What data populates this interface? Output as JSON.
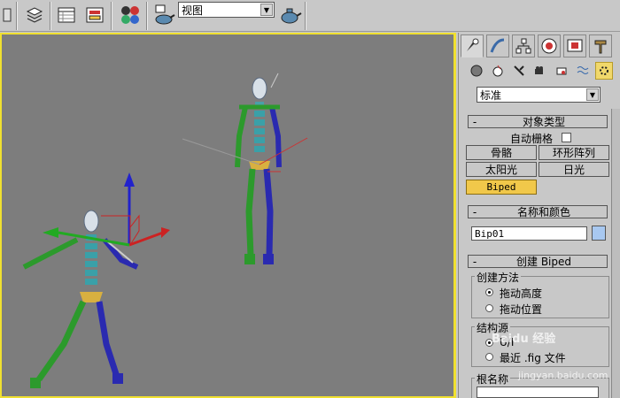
{
  "toolbar": {
    "view_dropdown": "视图",
    "icons": [
      "layers-icon",
      "track-view-icon",
      "schematic-icon",
      "material-editor-icon",
      "render-setup-icon",
      "quick-render-icon"
    ]
  },
  "panel": {
    "tabs": [
      "create-tab",
      "modify-tab",
      "hierarchy-tab",
      "motion-tab",
      "display-tab",
      "utilities-tab"
    ],
    "sub_icons": [
      "geometry-icon",
      "shapes-icon",
      "lights-icon",
      "cameras-icon",
      "helpers-icon",
      "space-warps-icon",
      "systems-icon"
    ],
    "category": "标准",
    "object_type": {
      "title": "对象类型",
      "autogrid": "自动栅格",
      "buttons": [
        "骨骼",
        "环形阵列",
        "太阳光",
        "日光",
        "Biped"
      ]
    },
    "name_color": {
      "title": "名称和颜色",
      "name_value": "Bip01"
    },
    "create_biped": {
      "title": "创建 Biped",
      "method_title": "创建方法",
      "methods": [
        "拖动高度",
        "拖动位置"
      ],
      "structure_title": "结构源",
      "structure_options": [
        "U/I",
        "最近 .fig 文件"
      ],
      "root_name_title": "根名称"
    }
  },
  "watermark": {
    "text": "Baidu 经验",
    "url": "jingyan.baidu.com"
  },
  "colors": {
    "viewport": "#7d7d7d",
    "viewport_border": "#f0e030",
    "active_button": "#f1c84a"
  }
}
